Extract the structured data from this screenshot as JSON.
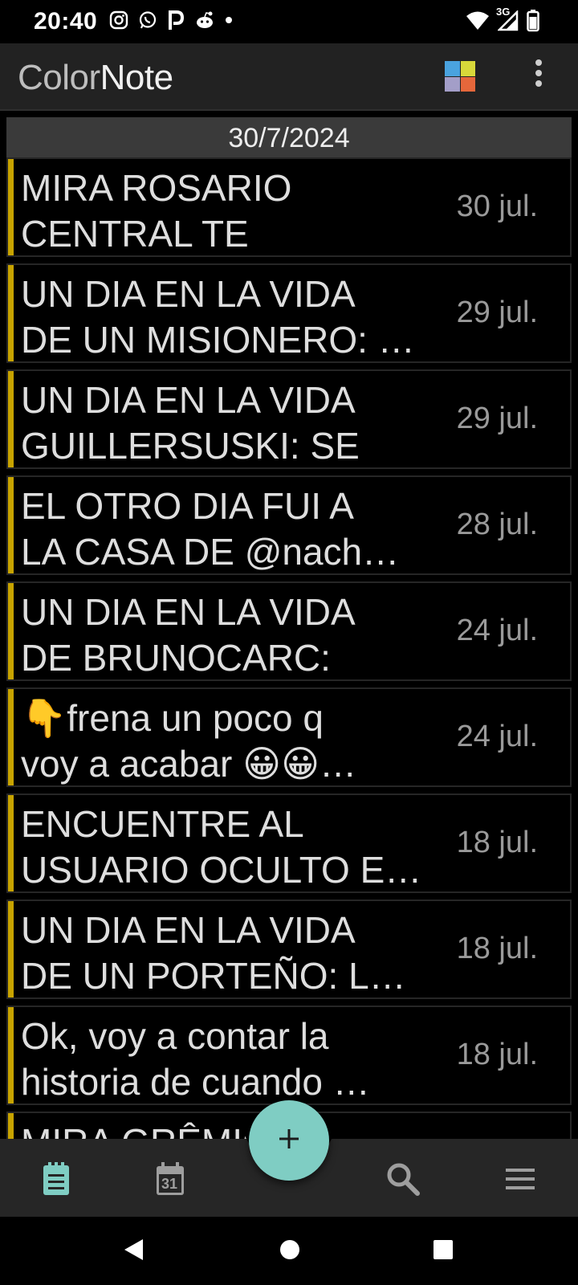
{
  "status_bar": {
    "time": "20:40",
    "left_icons": [
      "instagram-icon",
      "whatsapp-icon",
      "p-app-icon",
      "reddit-icon",
      "dot-icon"
    ],
    "network_label": "3G",
    "right_icons": [
      "wifi-icon",
      "signal-icon",
      "battery-icon"
    ]
  },
  "app_bar": {
    "logo_part1": "Color",
    "logo_part2": "Note",
    "color_grid": [
      "#4aa3df",
      "#d8d83a",
      "#a39ec8",
      "#e5673b"
    ]
  },
  "list": {
    "date_header": "30/7/2024",
    "accent_color": "#c7a300",
    "notes": [
      {
        "title": "MIRA ROSARIO\nCENTRAL TE PUEDO…",
        "date": "30 jul."
      },
      {
        "title": "UN DIA EN LA VIDA\nDE UN MISIONERO: …",
        "date": "29 jul."
      },
      {
        "title": "UN DIA EN LA VIDA\nGUILLERSUSKI: SE L…",
        "date": "29 jul."
      },
      {
        "title": "EL OTRO DIA FUI A\nLA CASA DE @nach…",
        "date": "28 jul."
      },
      {
        "title": "UN DIA EN LA VIDA\nDE BRUNOCARC: SE…",
        "date": "24 jul."
      },
      {
        "title": "👇frena un poco q\nvoy a acabar 😀😀…",
        "date": "24 jul."
      },
      {
        "title": "ENCUENTRE AL\nUSUARIO OCULTO E…",
        "date": "18 jul."
      },
      {
        "title": "UN DIA EN LA VIDA\nDE UN PORTEÑO: L…",
        "date": "18 jul."
      },
      {
        "title": "Ok, voy a contar la\nhistoria de cuando …",
        "date": "18 jul."
      },
      {
        "title": "MIRA GRÊMIO F",
        "date": ""
      }
    ]
  },
  "bottom_nav": {
    "items": [
      "notes-icon",
      "calendar-icon",
      "search-icon",
      "menu-icon"
    ],
    "calendar_day": "31",
    "fab_icon": "plus-icon",
    "active_color": "#7fcdc3"
  },
  "system_nav": [
    "back-icon",
    "home-icon",
    "recents-icon"
  ]
}
